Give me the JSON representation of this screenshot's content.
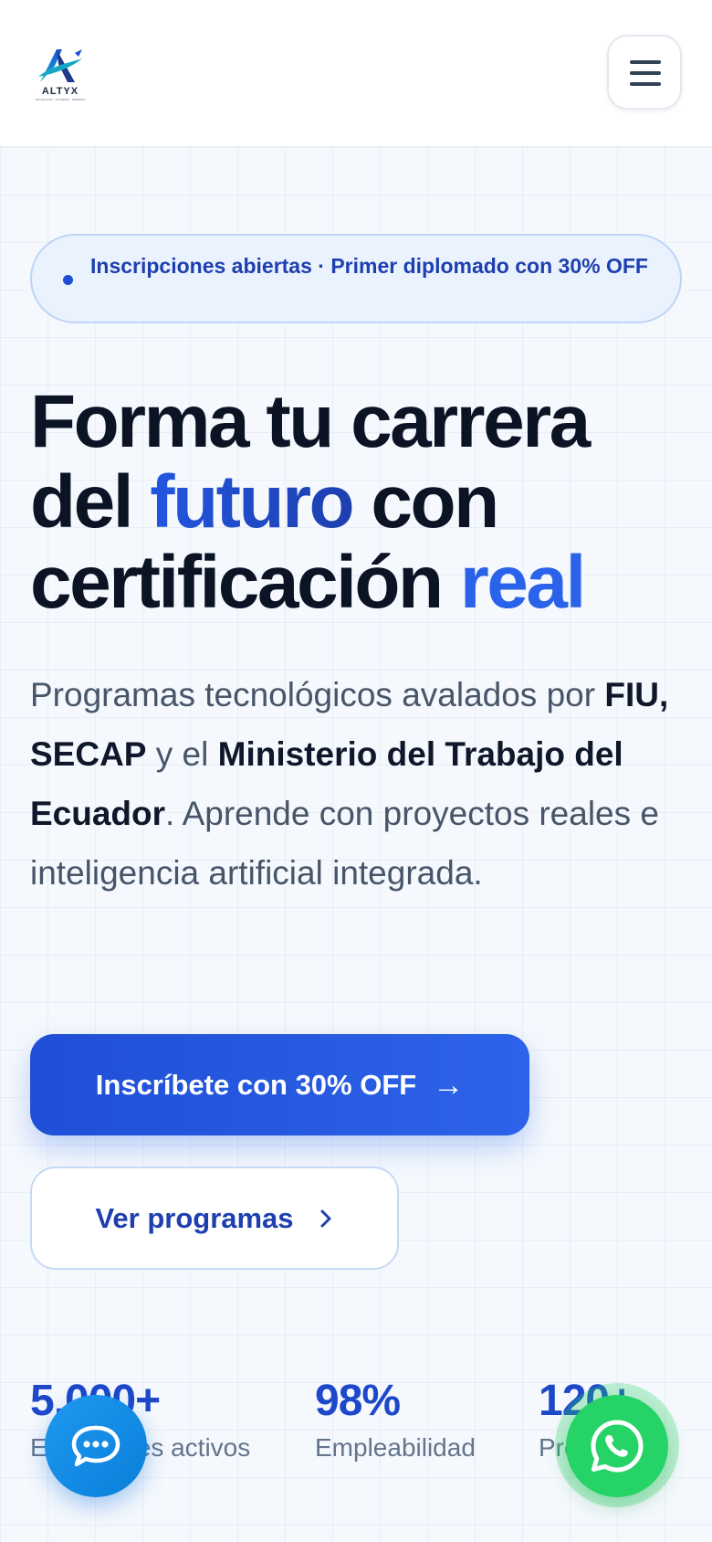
{
  "header": {
    "logo_text": "ALTYX",
    "logo_subtext": "TECNOLOGÍA · ACADEMIA · EMPRESA",
    "menu_icon": "hamburger-menu-icon"
  },
  "hero": {
    "badge_text": "Inscripciones abiertas · Primer diplomado con 30% OFF",
    "headline": {
      "part1": "Forma tu carrera del",
      "highlight1": "futuro",
      "part2": "con certificación",
      "highlight2": "real"
    },
    "description": {
      "text1": "Programas tecnológicos avalados por",
      "bold1": "FIU, SECAP",
      "text2": "y el",
      "bold2": "Ministerio del Trabajo del Ecuador",
      "text3": ". Aprende con proyectos reales e inteligencia artificial integrada."
    },
    "primary_cta": "Inscríbete con 30% OFF",
    "secondary_cta": "Ver programas"
  },
  "stats": [
    {
      "value": "5,000+",
      "label": "Estudiantes activos"
    },
    {
      "value": "98%",
      "label": "Empleabilidad"
    },
    {
      "value": "120+",
      "label": "Proyectos"
    }
  ],
  "floating": {
    "chat_icon": "chat-bubble-icon",
    "whatsapp_icon": "whatsapp-icon"
  },
  "colors": {
    "brand_blue": "#2256e0",
    "accent_blue": "#2a62ea",
    "whatsapp_green": "#25d366"
  }
}
